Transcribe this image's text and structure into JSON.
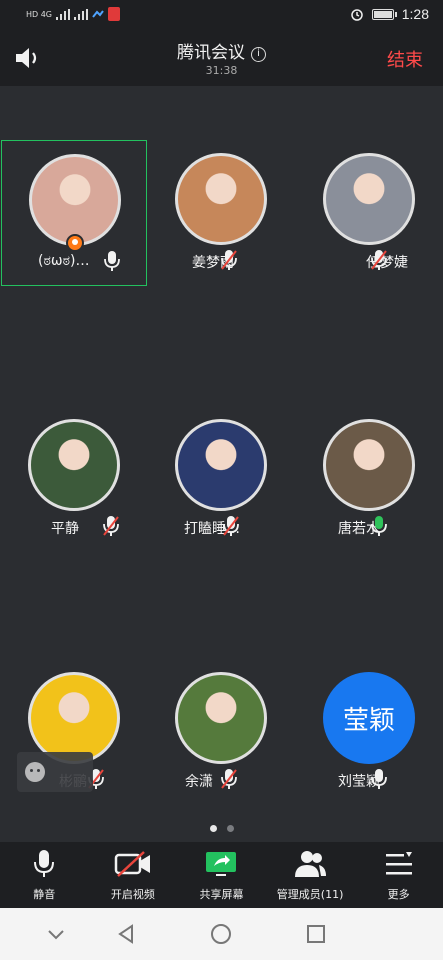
{
  "status_bar": {
    "time": "1:28",
    "network_left": "HD 4G",
    "icons": [
      "hd-icon",
      "signal-icon",
      "mic-recording-icon",
      "alarm-icon",
      "battery-icon"
    ]
  },
  "header": {
    "title": "腾讯会议",
    "timer": "31:38",
    "end_label": "结束"
  },
  "participants": [
    {
      "name": "(ಠωಠ)…",
      "mic": "on",
      "host": true,
      "active": true,
      "avatar_color": "#d8a89a"
    },
    {
      "name": "姜梦雨",
      "mic": "muted",
      "host": false,
      "active": false,
      "avatar_color": "#c6875a"
    },
    {
      "name": "任梦婕",
      "mic": "muted",
      "host": false,
      "active": false,
      "avatar_color": "#8a8f9a"
    },
    {
      "name": "平静",
      "mic": "muted",
      "host": false,
      "active": false,
      "avatar_color": "#3c5a3a"
    },
    {
      "name": "打瞌睡…",
      "mic": "muted",
      "host": false,
      "active": false,
      "avatar_color": "#2b3b6e"
    },
    {
      "name": "唐若水",
      "mic": "speaking",
      "host": false,
      "active": false,
      "avatar_color": "#6b5a48"
    },
    {
      "name": "彬鹂",
      "mic": "muted",
      "host": false,
      "active": false,
      "avatar_color": "#f2c21a"
    },
    {
      "name": "余潇",
      "mic": "muted",
      "host": false,
      "active": false,
      "avatar_color": "#557a3c"
    },
    {
      "name": "刘莹颖",
      "mic": "on",
      "host": false,
      "active": false,
      "avatar_text": "莹颖",
      "avatar_color": "#1878f0"
    }
  ],
  "pager": {
    "pages": 2,
    "current": 1
  },
  "toolbar": {
    "items": [
      {
        "label": "静音",
        "icon": "microphone-icon"
      },
      {
        "label": "开启视频",
        "icon": "video-off-icon"
      },
      {
        "label": "共享屏幕",
        "icon": "share-screen-icon"
      },
      {
        "label": "管理成员(11)",
        "icon": "members-icon"
      },
      {
        "label": "更多",
        "icon": "more-menu-icon"
      }
    ]
  },
  "colors": {
    "accent_green": "#23c15f",
    "end_red": "#ff4a4a",
    "mute_red": "#e8453c",
    "blue_avatar": "#1878f0"
  }
}
